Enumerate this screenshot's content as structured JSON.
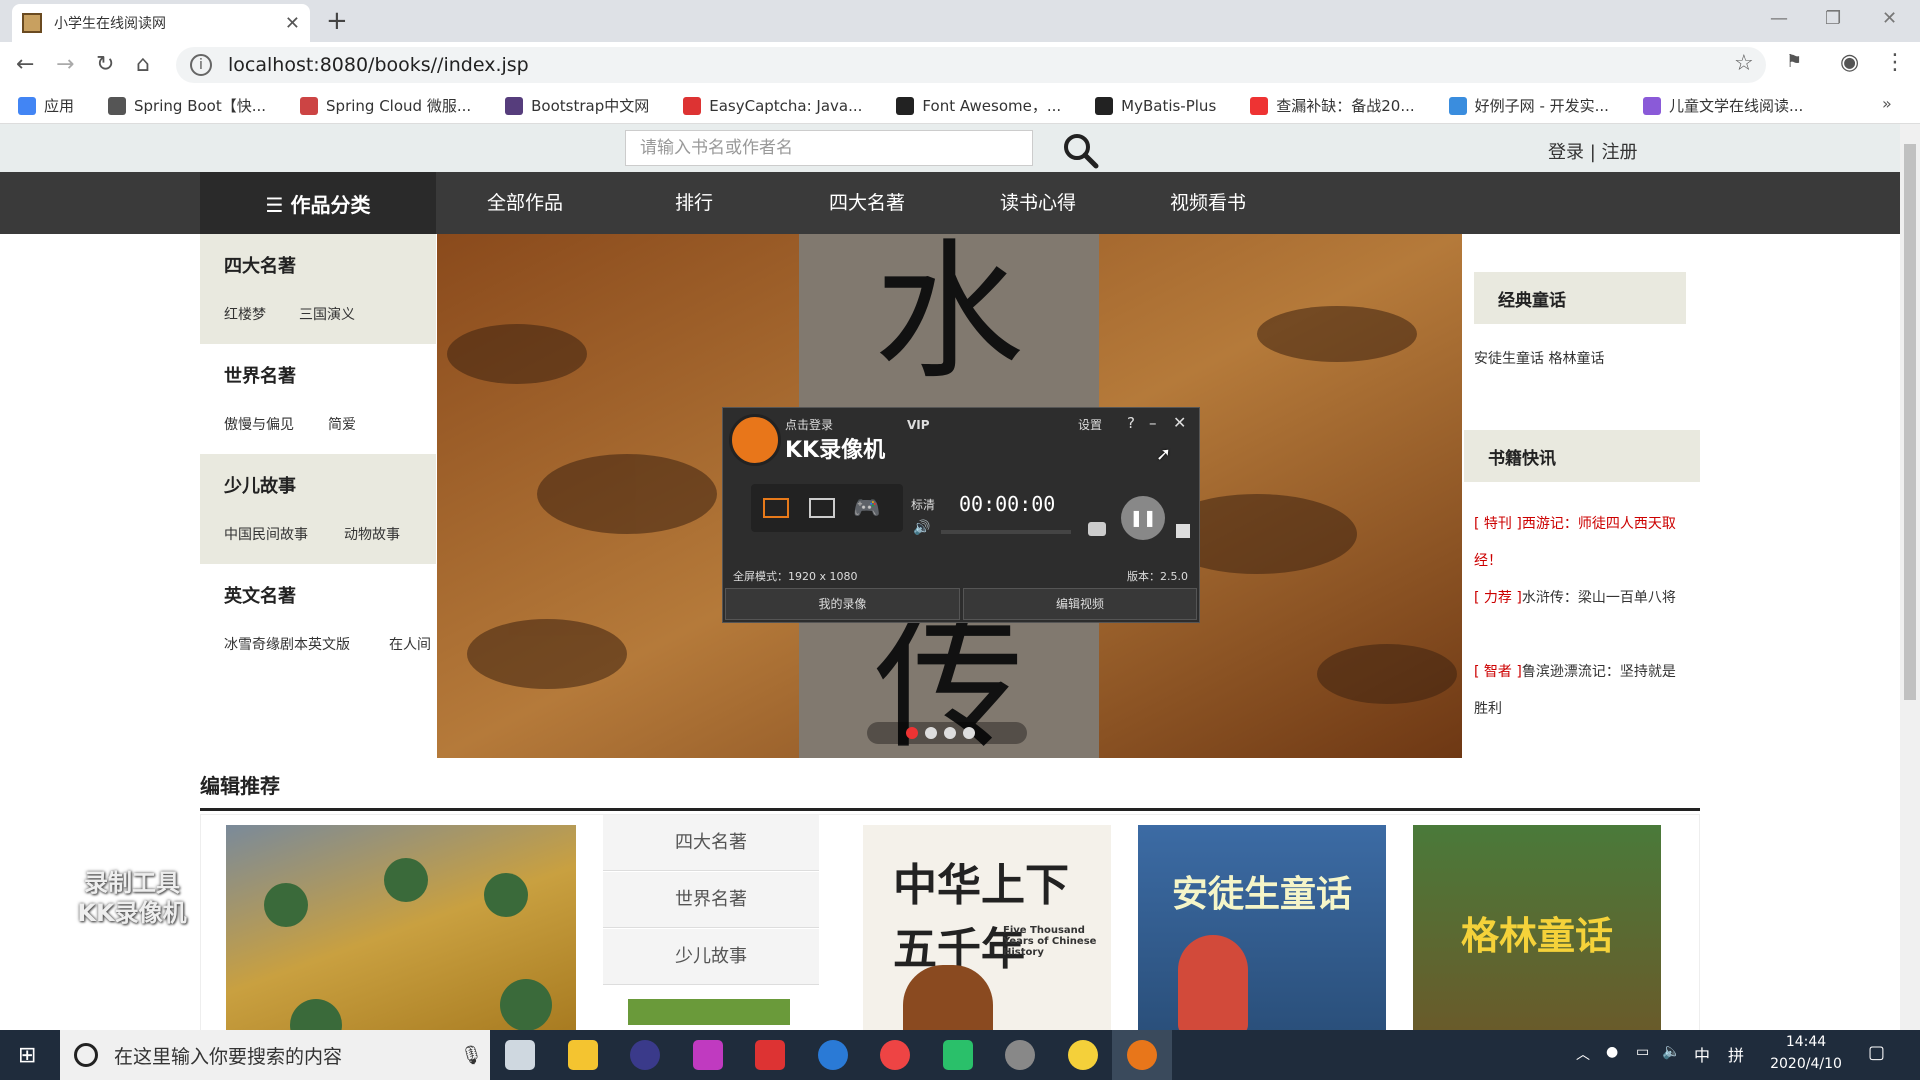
{
  "browser": {
    "tab_title": "小学生在线阅读网",
    "new_tab": "+",
    "close_tab": "✕",
    "url": "localhost:8080/books//index.jsp"
  },
  "bookmarks": [
    {
      "label": "应用",
      "icon": "apps-grid-icon",
      "color": "#4285f4"
    },
    {
      "label": "Spring Boot【快...",
      "icon": "spring-icon",
      "color": "#555555"
    },
    {
      "label": "Spring Cloud 微服...",
      "icon": "spring-cloud-icon",
      "color": "#c44"
    },
    {
      "label": "Bootstrap中文网",
      "icon": "bootstrap-icon",
      "color": "#563d7c"
    },
    {
      "label": "EasyCaptcha: Java...",
      "icon": "captcha-icon",
      "color": "#d33"
    },
    {
      "label": "Font Awesome，...",
      "icon": "flag-icon",
      "color": "#222"
    },
    {
      "label": "MyBatis-Plus",
      "icon": "bird-icon",
      "color": "#222"
    },
    {
      "label": "查漏补缺：备战20...",
      "icon": "csdn-icon",
      "color": "#e33"
    },
    {
      "label": "好例子网 - 开发实...",
      "icon": "haolizi-icon",
      "color": "#3a8dde"
    },
    {
      "label": "儿童文学在线阅读...",
      "icon": "book-icon",
      "color": "#8a5ad8"
    }
  ],
  "site": {
    "search_placeholder": "请输入书名或作者名",
    "login": "登录 | 注册",
    "category_menu": "☰ 作品分类",
    "nav": [
      "全部作品",
      "排行",
      "四大名著",
      "读书心得",
      "视频看书"
    ],
    "sidebar": [
      {
        "title": "四大名著",
        "links": [
          "红楼梦",
          "三国演义"
        ]
      },
      {
        "title": "世界名著",
        "links": [
          "傲慢与偏见",
          "简爱"
        ]
      },
      {
        "title": "少儿故事",
        "links": [
          "中国民间故事",
          "动物故事"
        ]
      },
      {
        "title": "英文名著",
        "links": [
          "冰雪奇缘剧本英文版",
          "在人间"
        ]
      }
    ],
    "banner_chars": [
      "水",
      "传"
    ],
    "classic": {
      "title": "经典童话",
      "text": "安徒生童话 格林童话"
    },
    "news": {
      "title": "书籍快讯",
      "items": [
        {
          "tag": "[ 特刊 ]",
          "text": "西游记：师徒四人西天取经！",
          "tag_color": "#cc0000"
        },
        {
          "tag": "[ 力荐 ]",
          "text": "水浒传：梁山一百单八将",
          "tag_color": "#cc0000"
        },
        {
          "tag": "[ 智者 ]",
          "text": "鲁滨逊漂流记：坚持就是胜利",
          "tag_color": "#cc0000"
        }
      ]
    },
    "recommend_title": "编辑推荐",
    "recommend_tabs": [
      "四大名著",
      "世界名著",
      "少儿故事"
    ],
    "covers": [
      {
        "title": "中华上下五千年",
        "subtitle": "Five Thousand Years of Chinese History"
      },
      {
        "title": "安徒生童话"
      },
      {
        "title": "格林童话"
      }
    ]
  },
  "recorder": {
    "login": "点击登录",
    "vip": "VIP",
    "settings": "设置",
    "help": "?",
    "minimize": "–",
    "close": "✕",
    "name": "KK录像机",
    "quality": "标清",
    "timer": "00:00:00",
    "mode": "全屏模式：1920 x 1080",
    "version": "版本：2.5.0",
    "my_recordings": "我的录像",
    "edit_video": "编辑视频",
    "watermark": [
      "录制工具",
      "KK录像机"
    ]
  },
  "taskbar": {
    "search": "在这里输入你要搜索的内容",
    "time": "14:44",
    "date": "2020/4/10",
    "ime": "中",
    "ime2": "拼"
  },
  "colors": {
    "accent_red": "#cc0000",
    "nav_bg": "#3a3a3a",
    "page_bg": "#e8eded"
  }
}
